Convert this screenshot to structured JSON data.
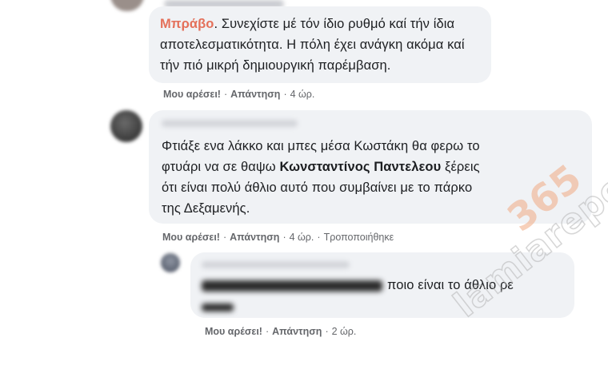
{
  "comments": [
    {
      "mention": "Μπράβο",
      "lines": [
        ". Συνεχίστε μέ τόν ίδιο ρυθμό καί τήν ίδια",
        "αποτελεσματικότητα. Η πόλη έχει ανάγκη ακόμα καί",
        "τήν πιό μικρή δημιουργική παρέμβαση."
      ],
      "like": "Μου αρέσει!",
      "reply": "Απάντηση",
      "time": "4 ώρ."
    },
    {
      "line1": "Φτιάξε ενα λάκκο και μπες μέσα Κωστάκη θα φερω το",
      "line2_pre": "φτυάρι να σε θαψω ",
      "line2_tag": "Κωνσταντίνος Παντελεου",
      "line2_post": " ξέρεις",
      "line3": "ότι είναι πολύ άθλιο αυτό που συμβαίνει με το πάρκο",
      "line4": "της Δεξαμενής.",
      "like": "Μου αρέσει!",
      "reply": "Απάντηση",
      "time": "4 ώρ.",
      "edited": "Τροποποιήθηκε"
    },
    {
      "line1_visible": "ποιο είναι το άθλιο ρε",
      "like": "Μου αρέσει!",
      "reply": "Απάντηση",
      "time": "2 ώρ."
    }
  ],
  "watermark": {
    "name": "lamiareport",
    "number": "365"
  },
  "colors": {
    "bubble": "#f0f2f5",
    "mention": "#e4705a",
    "meta": "#65676b"
  }
}
